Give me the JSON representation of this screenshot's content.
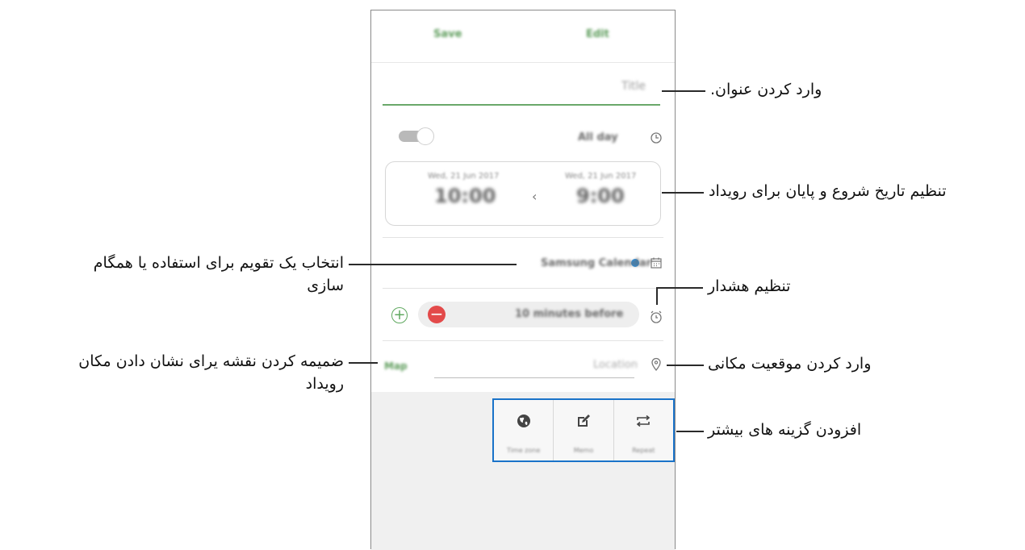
{
  "phone": {
    "topbar": {
      "left_button": "Save",
      "right_button": "Edit"
    },
    "title_placeholder": "Title",
    "all_day_label": "All day",
    "date_start": {
      "small": "Wed, 21 Jun 2017",
      "time": "9:00"
    },
    "date_end": {
      "small": "Wed, 21 Jun 2017",
      "time": "10:00"
    },
    "calendar_label": "Samsung Calendar",
    "alarm_label": "10 minutes before",
    "location_placeholder": "Location",
    "map_button": "Map",
    "options": [
      {
        "icon": "globe-icon",
        "label": "Time zone"
      },
      {
        "icon": "note-icon",
        "label": "Memo"
      },
      {
        "icon": "repeat-icon",
        "label": "Repeat"
      }
    ]
  },
  "callouts": {
    "title": "وارد کردن عنوان.",
    "date": "تنظیم تاریخ شروع و پایان برای رویداد",
    "calendar_line1": "انتخاب یک تقویم برای استفاده یا همگام",
    "calendar_line2": "سازی",
    "alarm": "تنظیم هشدار",
    "map_line1": "ضمیمه کردن نقشه یرای نشان دادن مکان",
    "map_line2": "رویداد",
    "location": "وارد کردن موقعیت مکانی",
    "more": "افزودن گزینه های بیشتر"
  },
  "colors": {
    "accent_green": "#5d9c5b",
    "calendar_dot": "#2196f3",
    "alarm_minus": "#e34a4a",
    "highlight_box": "#1a73c9"
  }
}
